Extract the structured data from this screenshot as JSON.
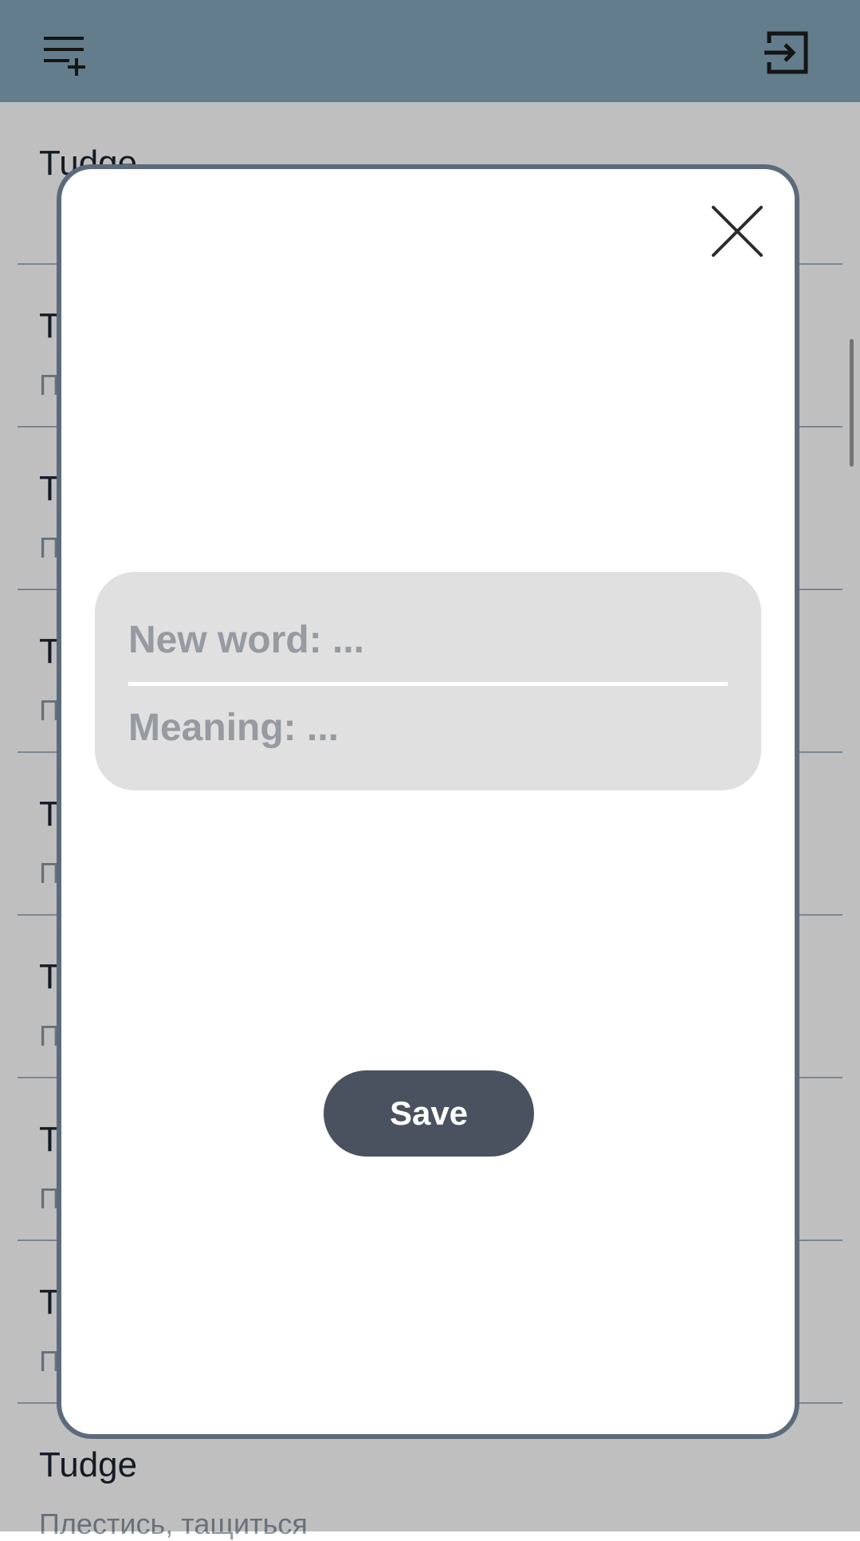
{
  "app_bar": {
    "background": "#86a7bb",
    "left_icon": "playlist-add-icon",
    "right_icon": "exit-icon"
  },
  "word_list": {
    "items": [
      {
        "word": "Tudge",
        "meaning": ""
      },
      {
        "word": "T",
        "meaning": "П"
      },
      {
        "word": "T",
        "meaning": "П"
      },
      {
        "word": "T",
        "meaning": "П"
      },
      {
        "word": "T",
        "meaning": "П"
      },
      {
        "word": "T",
        "meaning": "П"
      },
      {
        "word": "T",
        "meaning": "П"
      },
      {
        "word": "T",
        "meaning": "П"
      },
      {
        "word": "Tudge",
        "meaning": "Плестись, тащиться"
      }
    ]
  },
  "dialog": {
    "close_icon": "close-icon",
    "word_placeholder": "New word: ...",
    "meaning_placeholder": "Meaning: ...",
    "save_label": "Save",
    "border_color": "#5b6b7b",
    "button_color": "#49525e"
  }
}
